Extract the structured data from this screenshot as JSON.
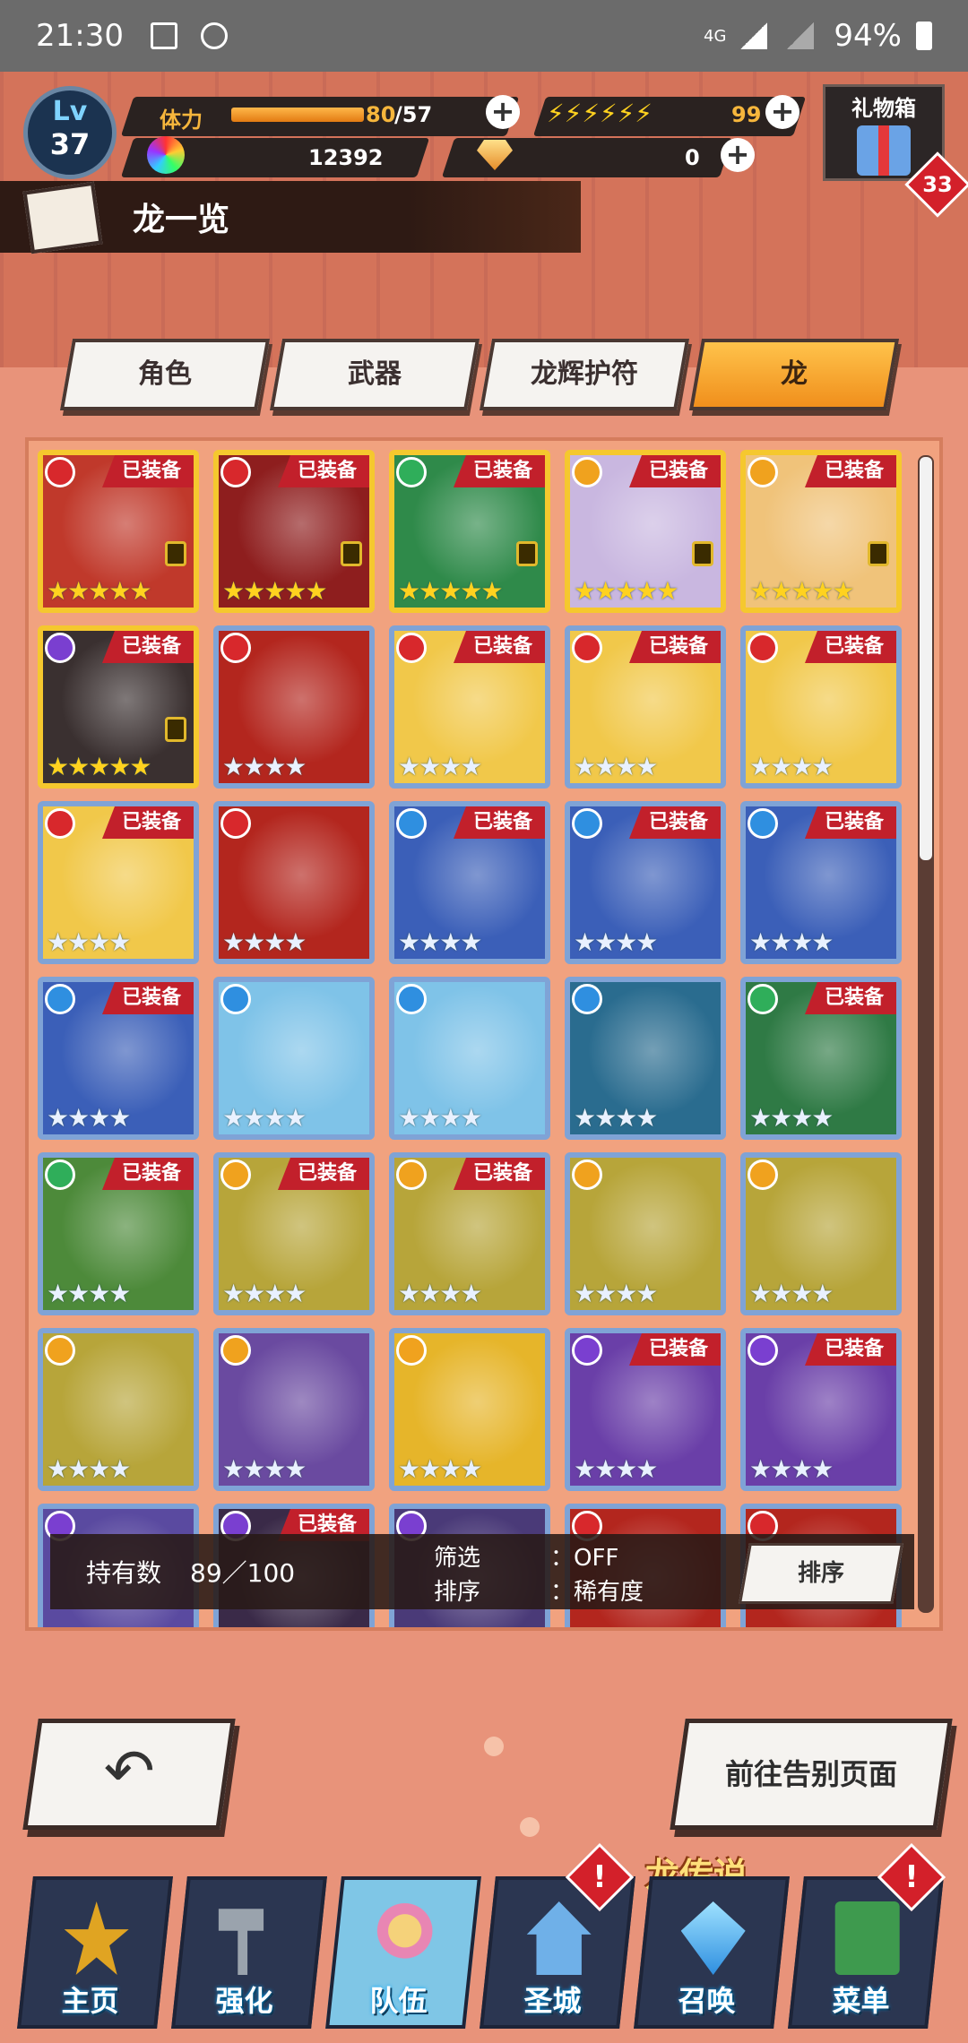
{
  "status_bar": {
    "time": "21:30",
    "network": "4G",
    "battery": "94%"
  },
  "header": {
    "level_label": "Lv",
    "level": "37",
    "stamina_label": "体力",
    "stamina_current": "80",
    "stamina_max": "/57",
    "energy_value": "99",
    "crystal_value": "12392",
    "gem_value": "0",
    "gift_label": "礼物箱",
    "gift_badge": "33"
  },
  "page": {
    "title": "龙一览"
  },
  "tabs": [
    {
      "label": "角色"
    },
    {
      "label": "武器"
    },
    {
      "label": "龙辉护符"
    },
    {
      "label": "龙",
      "active": true
    }
  ],
  "grid": {
    "equipped_label": "已装备",
    "cells": [
      {
        "element": "fire",
        "equipped": true,
        "stars": "★★★★★",
        "rarity": "gold",
        "locked": true,
        "color": "#c0392b"
      },
      {
        "element": "fire",
        "equipped": true,
        "stars": "★★★★★",
        "rarity": "gold",
        "locked": true,
        "color": "#8e1e1e"
      },
      {
        "element": "wind",
        "equipped": true,
        "stars": "★★★★★",
        "rarity": "gold",
        "locked": true,
        "color": "#2f8a4a"
      },
      {
        "element": "light",
        "equipped": true,
        "stars": "★★★★★",
        "rarity": "gold",
        "locked": true,
        "color": "#c9b7e0"
      },
      {
        "element": "light",
        "equipped": true,
        "stars": "★★★★★",
        "rarity": "gold",
        "locked": true,
        "color": "#f0c37a"
      },
      {
        "element": "shadow",
        "equipped": true,
        "stars": "★★★★★",
        "rarity": "gold",
        "locked": true,
        "color": "#3a3030"
      },
      {
        "element": "fire",
        "equipped": false,
        "stars": "★★★★",
        "rarity": "silver",
        "locked": false,
        "color": "#b3261e"
      },
      {
        "element": "fire",
        "equipped": true,
        "stars": "★★★★",
        "rarity": "silver",
        "locked": false,
        "color": "#f1c84a"
      },
      {
        "element": "fire",
        "equipped": true,
        "stars": "★★★★",
        "rarity": "silver",
        "locked": false,
        "color": "#f1c84a"
      },
      {
        "element": "fire",
        "equipped": true,
        "stars": "★★★★",
        "rarity": "silver",
        "locked": false,
        "color": "#f1c84a"
      },
      {
        "element": "fire",
        "equipped": true,
        "stars": "★★★★",
        "rarity": "silver",
        "locked": false,
        "color": "#f1c84a"
      },
      {
        "element": "fire",
        "equipped": false,
        "stars": "★★★★",
        "rarity": "silver",
        "locked": false,
        "color": "#b3261e"
      },
      {
        "element": "water",
        "equipped": true,
        "stars": "★★★★",
        "rarity": "silver",
        "locked": false,
        "color": "#3b5fb8"
      },
      {
        "element": "water",
        "equipped": true,
        "stars": "★★★★",
        "rarity": "silver",
        "locked": false,
        "color": "#3b5fb8"
      },
      {
        "element": "water",
        "equipped": true,
        "stars": "★★★★",
        "rarity": "silver",
        "locked": false,
        "color": "#3b5fb8"
      },
      {
        "element": "water",
        "equipped": true,
        "stars": "★★★★",
        "rarity": "silver",
        "locked": false,
        "color": "#3b5fb8"
      },
      {
        "element": "water",
        "equipped": false,
        "stars": "★★★★",
        "rarity": "silver",
        "locked": false,
        "color": "#7fc3e8"
      },
      {
        "element": "water",
        "equipped": false,
        "stars": "★★★★",
        "rarity": "silver",
        "locked": false,
        "color": "#7fc3e8"
      },
      {
        "element": "water",
        "equipped": false,
        "stars": "★★★★",
        "rarity": "silver",
        "locked": false,
        "color": "#2a6c8f"
      },
      {
        "element": "wind",
        "equipped": true,
        "stars": "★★★★",
        "rarity": "silver",
        "locked": false,
        "color": "#2f7a45"
      },
      {
        "element": "wind",
        "equipped": true,
        "stars": "★★★★",
        "rarity": "silver",
        "locked": false,
        "color": "#4d8a3a"
      },
      {
        "element": "light",
        "equipped": true,
        "stars": "★★★★",
        "rarity": "silver",
        "locked": false,
        "color": "#b7a53a"
      },
      {
        "element": "light",
        "equipped": true,
        "stars": "★★★★",
        "rarity": "silver",
        "locked": false,
        "color": "#b7a53a"
      },
      {
        "element": "light",
        "equipped": false,
        "stars": "★★★★",
        "rarity": "silver",
        "locked": false,
        "color": "#b7a53a"
      },
      {
        "element": "light",
        "equipped": false,
        "stars": "★★★★",
        "rarity": "silver",
        "locked": false,
        "color": "#b7a53a"
      },
      {
        "element": "light",
        "equipped": false,
        "stars": "★★★★",
        "rarity": "silver",
        "locked": false,
        "color": "#b7a53a"
      },
      {
        "element": "light",
        "equipped": false,
        "stars": "★★★★",
        "rarity": "silver",
        "locked": false,
        "color": "#6a4aa0"
      },
      {
        "element": "light",
        "equipped": false,
        "stars": "★★★★",
        "rarity": "silver",
        "locked": false,
        "color": "#e6b52a"
      },
      {
        "element": "shadow",
        "equipped": true,
        "stars": "★★★★",
        "rarity": "silver",
        "locked": false,
        "color": "#6a3fa8"
      },
      {
        "element": "shadow",
        "equipped": true,
        "stars": "★★★★",
        "rarity": "silver",
        "locked": false,
        "color": "#6a3fa8"
      },
      {
        "element": "shadow",
        "equipped": false,
        "stars": "",
        "rarity": "silver",
        "locked": false,
        "color": "#5a4aa0"
      },
      {
        "element": "shadow",
        "equipped": true,
        "stars": "",
        "rarity": "silver",
        "locked": false,
        "color": "#3a2a48"
      },
      {
        "element": "shadow",
        "equipped": false,
        "stars": "",
        "rarity": "silver",
        "locked": false,
        "color": "#4a3a78"
      },
      {
        "element": "fire",
        "equipped": false,
        "stars": "",
        "rarity": "silver",
        "locked": false,
        "color": "#b3261e"
      },
      {
        "element": "fire",
        "equipped": false,
        "stars": "",
        "rarity": "silver",
        "locked": false,
        "color": "#b3261e"
      }
    ]
  },
  "info_bar": {
    "owned_label": "持有数",
    "owned_value": "89／100",
    "filter_label": "筛选",
    "filter_value": "：OFF",
    "sort_label": "排序",
    "sort_value": "：稀有度",
    "sort_button": "排序"
  },
  "buttons": {
    "back": "↶",
    "farewell": "前往告别页面"
  },
  "legend_banner": "龙传说",
  "nav": [
    {
      "label": "主页",
      "icon": "home-star-icon"
    },
    {
      "label": "强化",
      "icon": "hammer-icon"
    },
    {
      "label": "队伍",
      "icon": "party-icon",
      "active": true
    },
    {
      "label": "圣城",
      "icon": "castle-icon",
      "alert": true
    },
    {
      "label": "召唤",
      "icon": "crystal-icon"
    },
    {
      "label": "菜单",
      "icon": "book-icon",
      "alert": true
    }
  ],
  "alert_glyph": "!",
  "element_colors": {
    "fire": "#d8282c",
    "water": "#2f8fe0",
    "wind": "#2fae5a",
    "light": "#f0a21e",
    "shadow": "#7a3fd0"
  }
}
